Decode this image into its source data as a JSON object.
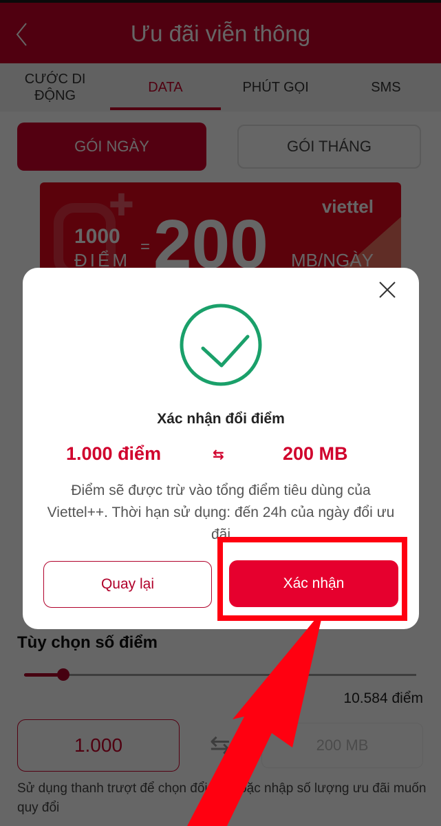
{
  "header": {
    "title": "Ưu đãi viễn thông",
    "back_icon": "chevron-left-icon"
  },
  "tabs": [
    {
      "label": "CƯỚC DI\nĐỘNG",
      "active": false
    },
    {
      "label": "DATA",
      "active": true
    },
    {
      "label": "PHÚT GỌI",
      "active": false
    },
    {
      "label": "SMS",
      "active": false
    }
  ],
  "packages": {
    "day_label": "GÓI NGÀY",
    "month_label": "GÓI THÁNG",
    "selected": "day"
  },
  "banner": {
    "brand": "viettel",
    "points": "1000",
    "points_label": "ĐIỂM",
    "equals": "=",
    "amount": "200",
    "unit": "MB/NGÀY"
  },
  "options": {
    "title": "Tùy chọn số điểm",
    "slider_fraction": 0.1,
    "max_points": "10.584 điểm",
    "points_input_value": "1.000",
    "swap_icon": "swap-arrows-icon",
    "mb_output": "200 MB",
    "hint": "Sử dụng thanh trượt để chọn đổi đổi hoặc nhập số lượng ưu đãi muốn quy đổi"
  },
  "modal": {
    "status_icon": "check-circle-icon",
    "title": "Xác nhận đổi điểm",
    "points": "1.000 điểm",
    "exchange_icon": "⇆",
    "mb": "200 MB",
    "description": "Điểm sẽ được trừ vào tổng điểm tiêu dùng của Viettel++. Thời hạn sử dụng: đến 24h của ngày đổi ưu đãi",
    "back_label": "Quay lại",
    "confirm_label": "Xác nhận",
    "close_icon": "close-icon"
  },
  "colors": {
    "brand": "#c8002a",
    "confirm": "#e6002e",
    "success": "#1aa06a",
    "annotation": "#ff0010"
  }
}
